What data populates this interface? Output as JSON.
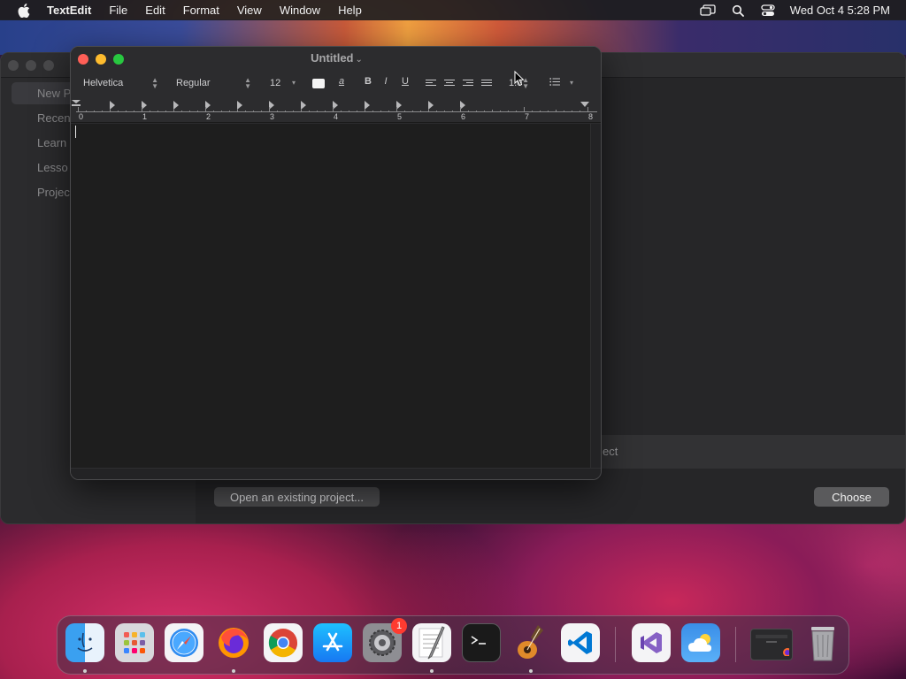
{
  "menubar": {
    "app_name": "TextEdit",
    "items": [
      "File",
      "Edit",
      "Format",
      "View",
      "Window",
      "Help"
    ],
    "clock": "Wed Oct 4  5:28 PM"
  },
  "background_window": {
    "sidebar_items": [
      "New P",
      "Recen",
      "Learn",
      "Lesso",
      "Projec"
    ],
    "strip_text": "ect",
    "open_button": "Open an existing project...",
    "choose_button": "Choose"
  },
  "textedit": {
    "title": "Untitled",
    "font_family": "Helvetica",
    "font_style": "Regular",
    "font_size": "12",
    "bold_label": "B",
    "italic_label": "I",
    "underline_label": "U",
    "line_spacing": "1.0",
    "ruler_numbers": [
      "0",
      "1",
      "2",
      "3",
      "4",
      "5",
      "6",
      "7",
      "8"
    ],
    "document_text": ""
  },
  "dock": {
    "apps": [
      "Finder",
      "Launchpad",
      "Safari",
      "Firefox",
      "Chrome",
      "App Store",
      "System Settings",
      "TextEdit",
      "Terminal",
      "GarageBand",
      "Visual Studio Code",
      "Visual Studio",
      "Weather",
      "Recent Window",
      "Trash"
    ],
    "settings_badge": "1"
  },
  "colors": {
    "close": "#ff5f57",
    "minimize": "#febc2e",
    "maximize": "#28c840",
    "badge": "#ff3b30"
  }
}
